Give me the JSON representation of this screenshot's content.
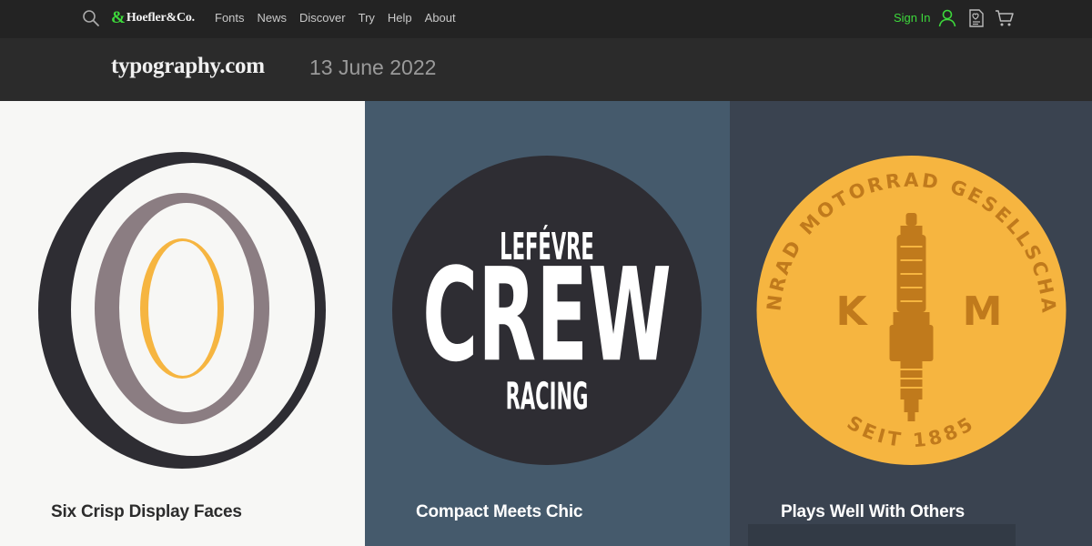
{
  "nav": {
    "brand_amp": "&",
    "brand_name": "Hoefler&Co.",
    "items": [
      "Fonts",
      "News",
      "Discover",
      "Try",
      "Help",
      "About"
    ],
    "signin": "Sign In",
    "icons": [
      "search-icon",
      "user-icon",
      "wishlist-icon",
      "cart-icon"
    ],
    "accent": "#3dd83b"
  },
  "subheader": {
    "site": "typography.com",
    "date": "13 June 2022"
  },
  "panels": [
    {
      "caption": "Six Crisp Display Faces",
      "art": {
        "letters": [
          "O",
          "O",
          "O"
        ],
        "colors": [
          "#2e2d33",
          "#8b7d82",
          "#f6b540"
        ]
      }
    },
    {
      "caption": "Compact Meets Chic",
      "art": {
        "top": "LEFÉVRE",
        "middle": "CREW",
        "bottom": "RACING",
        "circle_color": "#2e2d33"
      }
    },
    {
      "caption": "Plays Well With Others",
      "art": {
        "ring_text": "KONRAD MOTORRAD GESELLSCHAFT",
        "bottom_text": "SEIT 1885",
        "left_letter": "K",
        "right_letter": "M",
        "circle_color": "#f6b540",
        "ink_color": "#c07a1c"
      }
    }
  ]
}
